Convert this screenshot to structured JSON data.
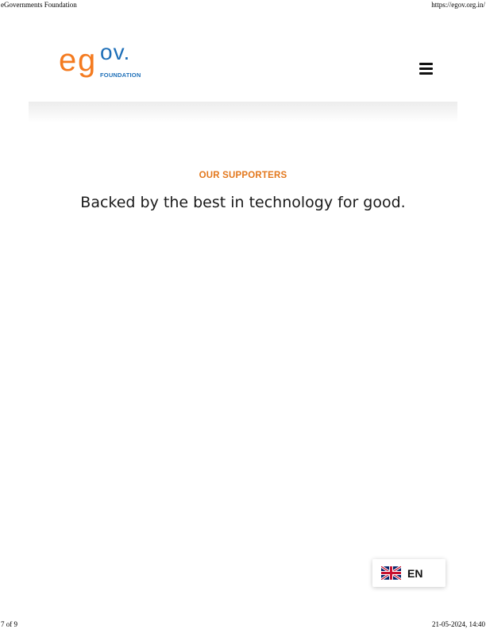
{
  "print": {
    "title": "eGovernments Foundation",
    "url": "https://egov.org.in/",
    "page": "7 of 9",
    "datetime": "21-05-2024, 14:40"
  },
  "header": {
    "logo_letters": {
      "e": "e",
      "g": "g",
      "ov": "ov."
    },
    "logo_subtitle": "FOUNDATION",
    "menu_icon": "hamburger-menu-icon"
  },
  "section": {
    "eyebrow": "OUR SUPPORTERS",
    "heading": "Backed by the best in technology for good."
  },
  "language": {
    "code": "EN",
    "flag_icon": "uk-flag-icon"
  },
  "colors": {
    "brand_orange": "#f47b20",
    "brand_blue": "#1e6fb8",
    "eyebrow_orange": "#e3781d"
  }
}
